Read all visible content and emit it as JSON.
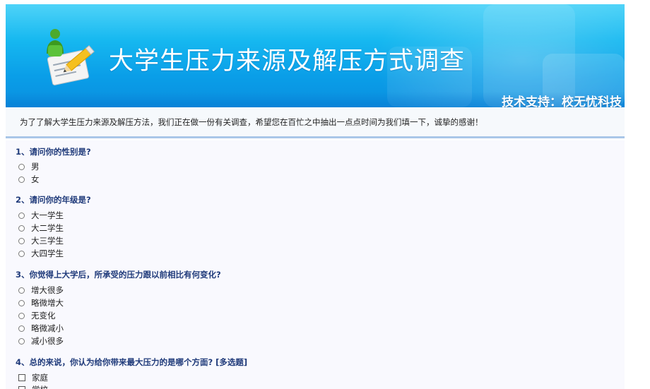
{
  "header": {
    "title": "大学生压力来源及解压方式调查",
    "tech_support": "技术支持：校无忧科技",
    "logo_icon": "survey-pencil-person-icon"
  },
  "intro": {
    "text": "为了了解大学生压力来源及解压方法，我们正在做一份有关调查，希望您在百忙之中抽出一点点时间为我们填一下，诚挚的感谢！"
  },
  "questions": [
    {
      "title": "1、请问你的性别是?",
      "type": "radio",
      "options": [
        "男",
        "女"
      ]
    },
    {
      "title": "2、请问你的年级是?",
      "type": "radio",
      "options": [
        "大一学生",
        "大二学生",
        "大三学生",
        "大四学生"
      ]
    },
    {
      "title": "3、你觉得上大学后，所承受的压力跟以前相比有何变化?",
      "type": "radio",
      "options": [
        "增大很多",
        "略微增大",
        "无变化",
        "略微减小",
        "减小很多"
      ]
    },
    {
      "title": "4、总的来说，你认为给你带来最大压力的是哪个方面? [多选题]",
      "type": "checkbox",
      "options": [
        "家庭",
        "学校"
      ]
    }
  ],
  "colors": {
    "banner_top": "#4fd3f8",
    "banner_bottom": "#0b8fdf",
    "question_title": "#1f3a7a",
    "divider": "#a9c7e8"
  }
}
